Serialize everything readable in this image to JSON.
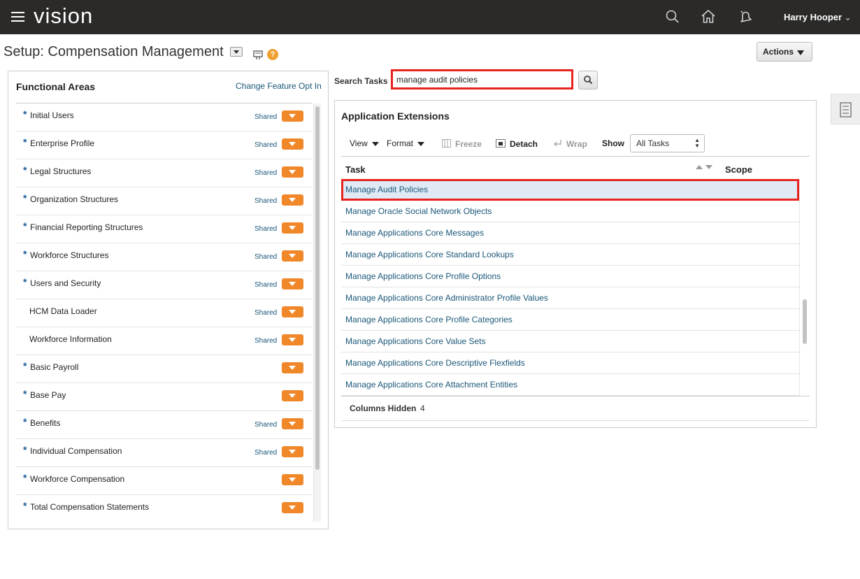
{
  "header": {
    "brand": "vision",
    "user_name": "Harry Hooper",
    "icons": [
      "menu-icon",
      "search-icon",
      "home-icon",
      "notifications-icon"
    ]
  },
  "page": {
    "title": "Setup: Compensation Management",
    "actions_label": "Actions"
  },
  "functional_areas": {
    "title": "Functional Areas",
    "change_link": "Change Feature Opt In",
    "items": [
      {
        "label": "Initial Users",
        "required": true,
        "shared": "Shared"
      },
      {
        "label": "Enterprise Profile",
        "required": true,
        "shared": "Shared"
      },
      {
        "label": "Legal Structures",
        "required": true,
        "shared": "Shared"
      },
      {
        "label": "Organization Structures",
        "required": true,
        "shared": "Shared"
      },
      {
        "label": "Financial Reporting Structures",
        "required": true,
        "shared": "Shared"
      },
      {
        "label": "Workforce Structures",
        "required": true,
        "shared": "Shared"
      },
      {
        "label": "Users and Security",
        "required": true,
        "shared": "Shared"
      },
      {
        "label": "HCM Data Loader",
        "required": false,
        "shared": "Shared"
      },
      {
        "label": "Workforce Information",
        "required": false,
        "shared": "Shared"
      },
      {
        "label": "Basic Payroll",
        "required": true,
        "shared": ""
      },
      {
        "label": "Base Pay",
        "required": true,
        "shared": ""
      },
      {
        "label": "Benefits",
        "required": true,
        "shared": "Shared"
      },
      {
        "label": "Individual Compensation",
        "required": true,
        "shared": "Shared"
      },
      {
        "label": "Workforce Compensation",
        "required": true,
        "shared": ""
      },
      {
        "label": "Total Compensation Statements",
        "required": true,
        "shared": ""
      }
    ],
    "required_marker": "*"
  },
  "search": {
    "label": "Search Tasks",
    "value": "manage audit policies"
  },
  "extensions": {
    "title": "Application Extensions",
    "toolbar": {
      "view": "View",
      "format": "Format",
      "freeze": "Freeze",
      "detach": "Detach",
      "wrap": "Wrap",
      "show": "Show",
      "show_value": "All Tasks"
    },
    "columns": {
      "task": "Task",
      "scope": "Scope"
    },
    "tasks": [
      "Manage Audit Policies",
      "Manage Oracle Social Network Objects",
      "Manage Applications Core Messages",
      "Manage Applications Core Standard Lookups",
      "Manage Applications Core Profile Options",
      "Manage Applications Core Administrator Profile Values",
      "Manage Applications Core Profile Categories",
      "Manage Applications Core Value Sets",
      "Manage Applications Core Descriptive Flexfields",
      "Manage Applications Core Attachment Entities"
    ],
    "selected_index": 0,
    "footer": {
      "columns_hidden_label": "Columns Hidden",
      "columns_hidden_count": "4"
    }
  },
  "colors": {
    "topbar": "#2b2a29",
    "accent_orange": "#f0882a",
    "link": "#1a5778",
    "highlight_red": "#e8231f",
    "selected_row": "#dfeaf5"
  }
}
